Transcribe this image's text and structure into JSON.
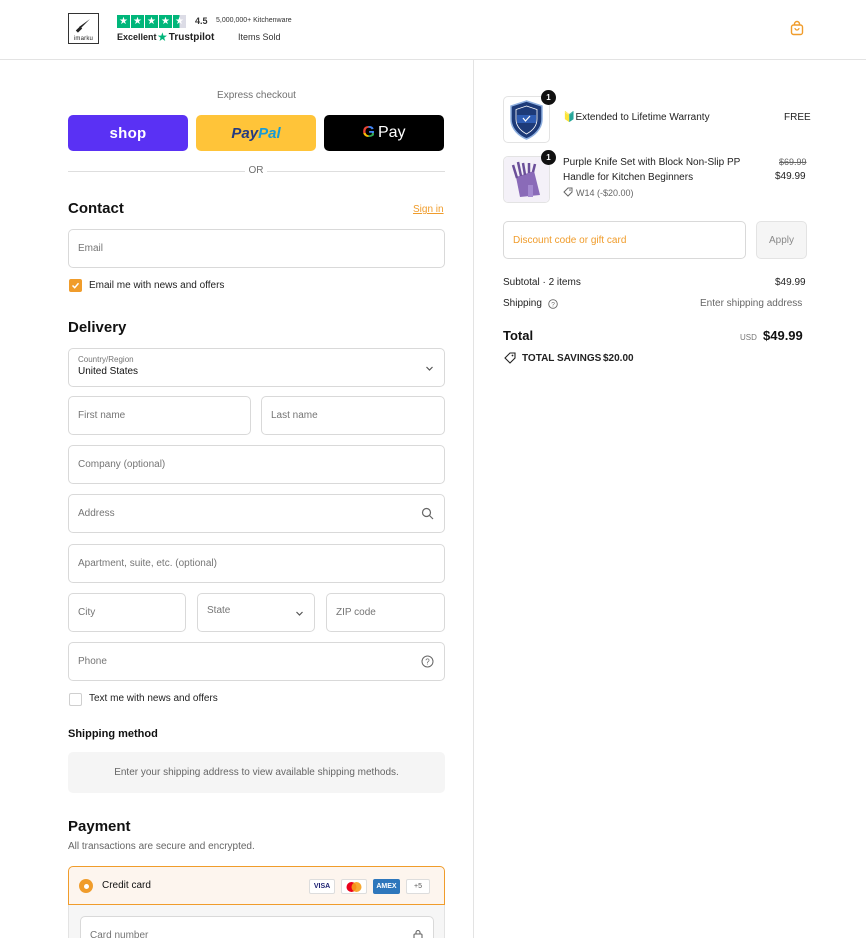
{
  "brand": {
    "logo_text": "imarku"
  },
  "trustpilot": {
    "score": "4.5",
    "excellent": "Excellent",
    "name": "Trustpilot"
  },
  "sold": {
    "count": "5,000,000+ Kitchenware",
    "label": "Items Sold"
  },
  "express": {
    "label": "Express checkout",
    "shop_label": "shop",
    "paypal_part1": "Pay",
    "paypal_part2": "Pal",
    "gpay_label": "Pay",
    "or_label": "OR"
  },
  "contact": {
    "title": "Contact",
    "signin": "Sign in",
    "email_placeholder": "Email",
    "news_label": "Email me with news and offers",
    "news_checked": true
  },
  "delivery": {
    "title": "Delivery",
    "country_label": "Country/Region",
    "country_value": "United States",
    "first_name": "First name",
    "last_name": "Last name",
    "company": "Company (optional)",
    "address": "Address",
    "apartment": "Apartment, suite, etc. (optional)",
    "city": "City",
    "state": "State",
    "zip": "ZIP code",
    "phone": "Phone",
    "sms_label": "Text me with news and offers"
  },
  "shipping_method": {
    "title": "Shipping method",
    "message": "Enter your shipping address to view available shipping methods."
  },
  "payment": {
    "title": "Payment",
    "subtitle": "All transactions are secure and encrypted.",
    "option_label": "Credit card",
    "cards": [
      "VISA",
      "",
      "AMEX",
      "+5"
    ],
    "card_number": "Card number"
  },
  "order": {
    "items": [
      {
        "qty": "1",
        "name": "🔰Extended to Lifetime Warranty",
        "price": "FREE"
      },
      {
        "qty": "1",
        "name_line1": "Purple Knife Set with Block Non-Slip PP",
        "name_line2": "Handle for Kitchen Beginners",
        "discount": "W14 (-$20.00)",
        "old_price": "$69.99",
        "price": "$49.99"
      }
    ],
    "discount_placeholder": "Discount code or gift card",
    "apply_label": "Apply",
    "subtotal_label": "Subtotal · 2 items",
    "subtotal_value": "$49.99",
    "shipping_label": "Shipping",
    "shipping_value": "Enter shipping address",
    "total_label": "Total",
    "currency": "USD",
    "total_value": "$49.99",
    "savings_label": "TOTAL SAVINGS",
    "savings_value": "$20.00"
  },
  "colors": {
    "accent": "#f09c2b",
    "shop": "#5a31f4",
    "paypal": "#ffc439",
    "trustpilot": "#00b67a"
  }
}
